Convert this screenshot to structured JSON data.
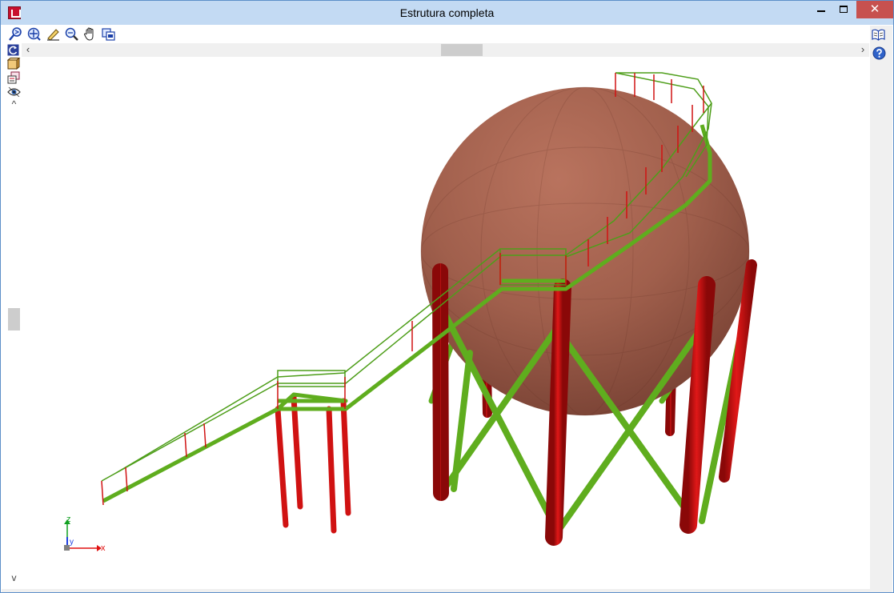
{
  "window": {
    "title": "Estrutura completa",
    "controls": {
      "minimize": "minimize-icon",
      "maximize": "maximize-icon",
      "close": "✕"
    }
  },
  "toolbar": {
    "icons": [
      "zoom-window-icon",
      "zoom-extents-icon",
      "pencil-edit-icon",
      "zoom-magnify-icon",
      "pan-hand-icon",
      "copy-view-icon"
    ],
    "right_icons": [
      "book-icon",
      "help-icon"
    ]
  },
  "left_tools": {
    "icons": [
      "rotate-icon",
      "view-box-icon",
      "layers-icon",
      "visibility-eye-icon"
    ]
  },
  "scrollbars": {
    "horizontal": {
      "left": "‹",
      "right": "›"
    },
    "vertical": {
      "up": "^",
      "down": "v"
    }
  },
  "axes": {
    "x": "x",
    "y": "y",
    "z": "z"
  },
  "colors": {
    "sphere": "#a4624f",
    "columns": "#d01212",
    "bracing": "#5fad1e",
    "railing": "#4e9e1a",
    "axis_x": "#e01010",
    "axis_y": "#2040e0",
    "axis_z": "#10a020",
    "title_bar": "#c3daf3",
    "close_button": "#c7514f"
  }
}
